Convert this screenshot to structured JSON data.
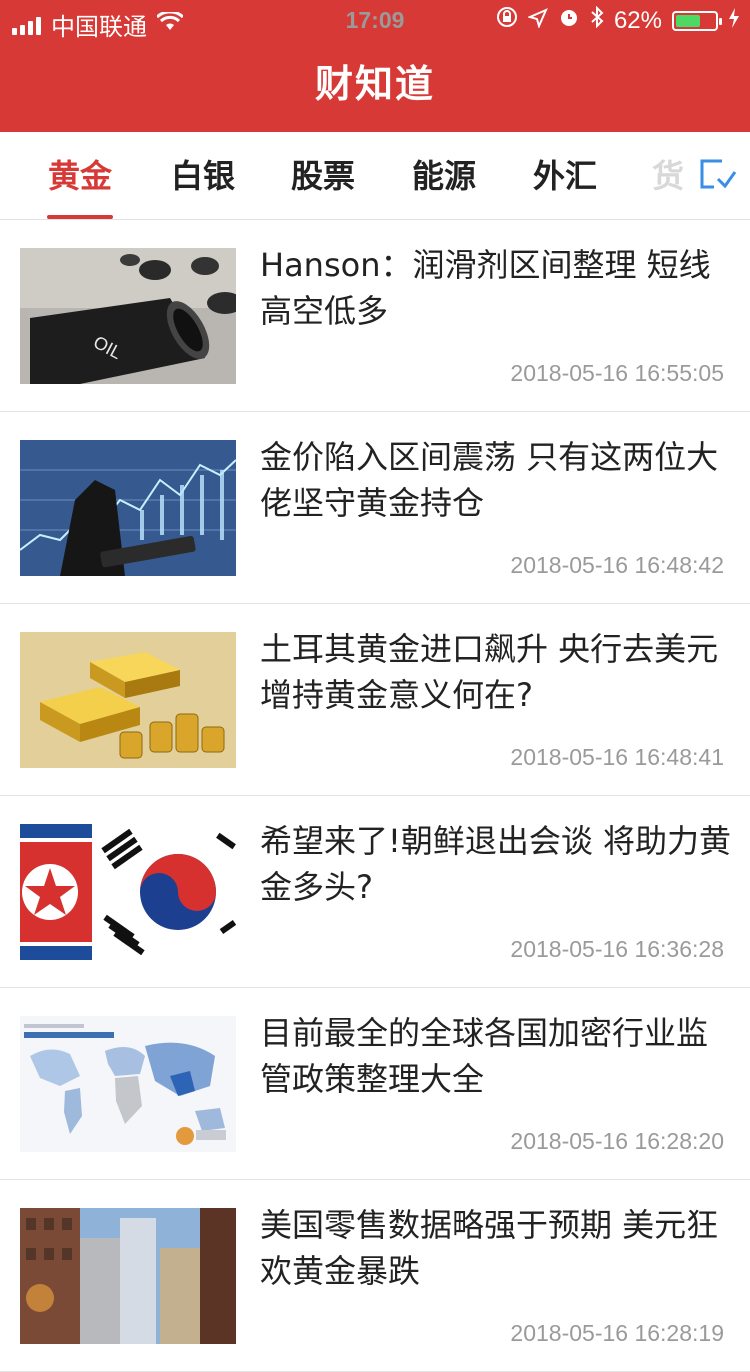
{
  "status_bar": {
    "carrier": "中国联通",
    "time": "17:09",
    "battery": "62%",
    "battery_level": 0.62,
    "icons": [
      "signal-icon",
      "wifi-icon",
      "lock-rotation-icon",
      "location-icon",
      "alarm-icon",
      "bluetooth-icon",
      "charging-icon"
    ]
  },
  "navbar": {
    "title": "财知道"
  },
  "tabs": {
    "items": [
      {
        "label": "黄金"
      },
      {
        "label": "白银"
      },
      {
        "label": "股票"
      },
      {
        "label": "能源"
      },
      {
        "label": "外汇"
      },
      {
        "label": "货"
      }
    ],
    "active_index": 0,
    "more_icon": "channel-edit-icon"
  },
  "articles": [
    {
      "title": "Hanson：润滑剂区间整理 短线高空低多",
      "time": "2018-05-16 16:55:05",
      "thumb_icon": "oil-barrel-image",
      "thumb_text": "OIL"
    },
    {
      "title": "金价陷入区间震荡 只有这两位大佬坚守黄金持仓",
      "time": "2018-05-16 16:48:42",
      "thumb_icon": "market-chart-image"
    },
    {
      "title": "土耳其黄金进口飙升 央行去美元增持黄金意义何在?",
      "time": "2018-05-16 16:48:41",
      "thumb_icon": "gold-bars-image"
    },
    {
      "title": "希望来了!朝鲜退出会谈 将助力黄金多头?",
      "time": "2018-05-16 16:36:28",
      "thumb_icon": "korea-flags-image"
    },
    {
      "title": "目前最全的全球各国加密行业监管政策整理大全",
      "time": "2018-05-16 16:28:20",
      "thumb_icon": "world-map-image"
    },
    {
      "title": "美国零售数据略强于预期 美元狂欢黄金暴跌",
      "time": "2018-05-16 16:28:19",
      "thumb_icon": "city-street-image"
    }
  ],
  "colors": {
    "brand": "#d73a36",
    "time_text": "#9a9a9a",
    "tab_more": "#3a8ee6"
  }
}
